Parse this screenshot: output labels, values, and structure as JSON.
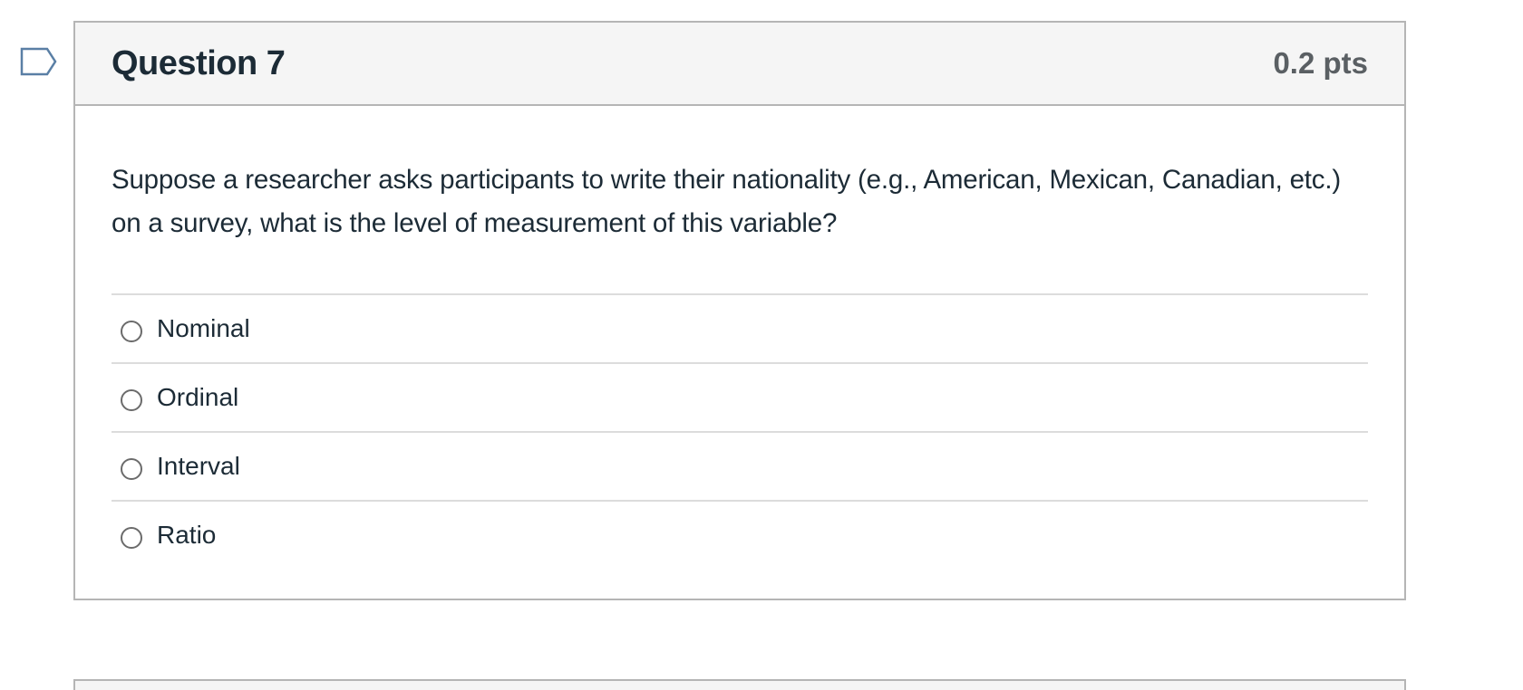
{
  "question": {
    "title": "Question 7",
    "points": "0.2 pts",
    "text": "Suppose a researcher asks participants to write their nationality (e.g., American, Mexican, Canadian, etc.) on a survey, what is the level of measurement of this variable?",
    "flag_icon": "flag-outline-icon",
    "answers": [
      {
        "label": "Nominal",
        "selected": false
      },
      {
        "label": "Ordinal",
        "selected": false
      },
      {
        "label": "Interval",
        "selected": false
      },
      {
        "label": "Ratio",
        "selected": false
      }
    ]
  },
  "colors": {
    "border": "#b5b5b5",
    "header_bg": "#f5f5f5",
    "text": "#1c2b36",
    "flag_outline": "#5a7fa5"
  }
}
